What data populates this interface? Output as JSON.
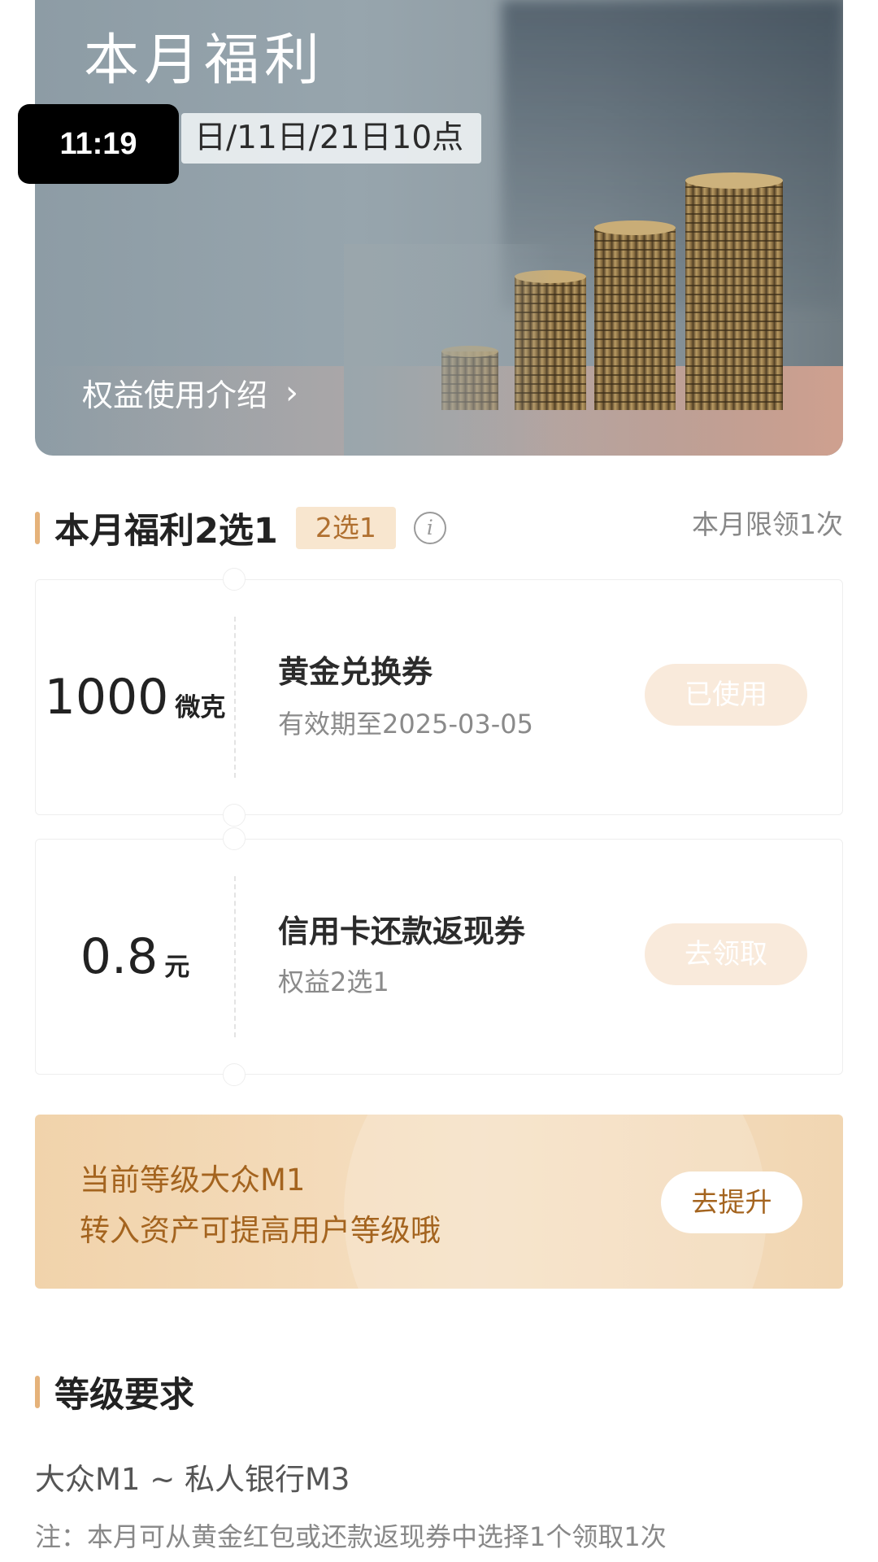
{
  "status_bar": {
    "time": "11:19"
  },
  "hero": {
    "title": "本月福利",
    "date_text": "日/11日/21日10点",
    "link_label": "权益使用介绍",
    "link_chevron": "›"
  },
  "benefits": {
    "title": "本月福利2选1",
    "tag": "2选1",
    "info_icon": "i",
    "limit_note": "本月限领1次",
    "coupons": [
      {
        "amount": "1000",
        "unit": "微克",
        "name": "黄金兑换券",
        "subtitle": "有效期至2025-03-05",
        "button": "已使用"
      },
      {
        "amount": "0.8",
        "unit": "元",
        "name": "信用卡还款返现券",
        "subtitle": "权益2选1",
        "button": "去领取"
      }
    ]
  },
  "level": {
    "line1": "当前等级大众M1",
    "line2": "转入资产可提高用户等级哦",
    "button": "去提升"
  },
  "requirements": {
    "title": "等级要求",
    "range": "大众M1 ~ 私人银行M3",
    "note": "注：本月可从黄金红包或还款返现券中选择1个领取1次"
  },
  "colors": {
    "accent": "#e5b27a",
    "tag_bg": "#f8e6cf",
    "level_text": "#a4641f",
    "disabled_button_bg": "#f9eadb"
  }
}
